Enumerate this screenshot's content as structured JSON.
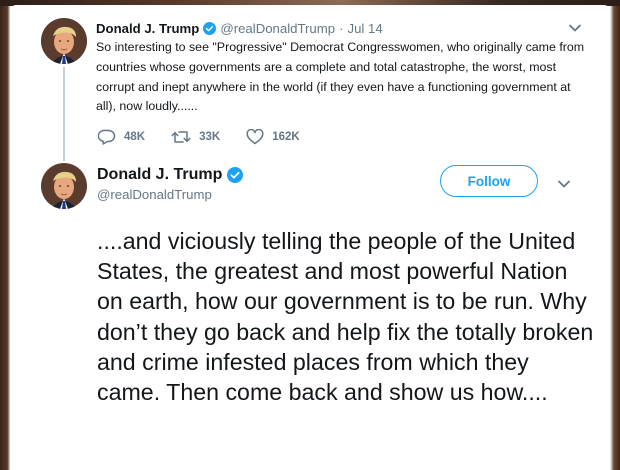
{
  "parent_tweet": {
    "display_name": "Donald J. Trump",
    "handle": "@realDonaldTrump",
    "separator": "·",
    "date": "Jul 14",
    "text": "So interesting to see \"Progressive\" Democrat Congresswomen, who originally came from countries whose governments are a complete and total catastrophe, the worst, most corrupt and inept anywhere in the world (if they even have a functioning government at all), now loudly......",
    "reply_count": "48K",
    "retweet_count": "33K",
    "like_count": "162K"
  },
  "main_tweet": {
    "display_name": "Donald J. Trump",
    "handle": "@realDonaldTrump",
    "follow_label": "Follow",
    "text": "....and viciously telling the people of the United States, the greatest and most powerful Nation on earth, how our government is to be run. Why don’t they go back and help fix the totally broken and crime infested places from which they came. Then come back and show us how...."
  },
  "colors": {
    "accent": "#1da1f2",
    "text_primary": "#14171a",
    "text_secondary": "#657786",
    "thread_line": "#c4cfd6"
  },
  "icons": {
    "verified": "verified-badge-icon",
    "reply": "reply-icon",
    "retweet": "retweet-icon",
    "like": "heart-icon",
    "menu": "chevron-down-icon"
  }
}
